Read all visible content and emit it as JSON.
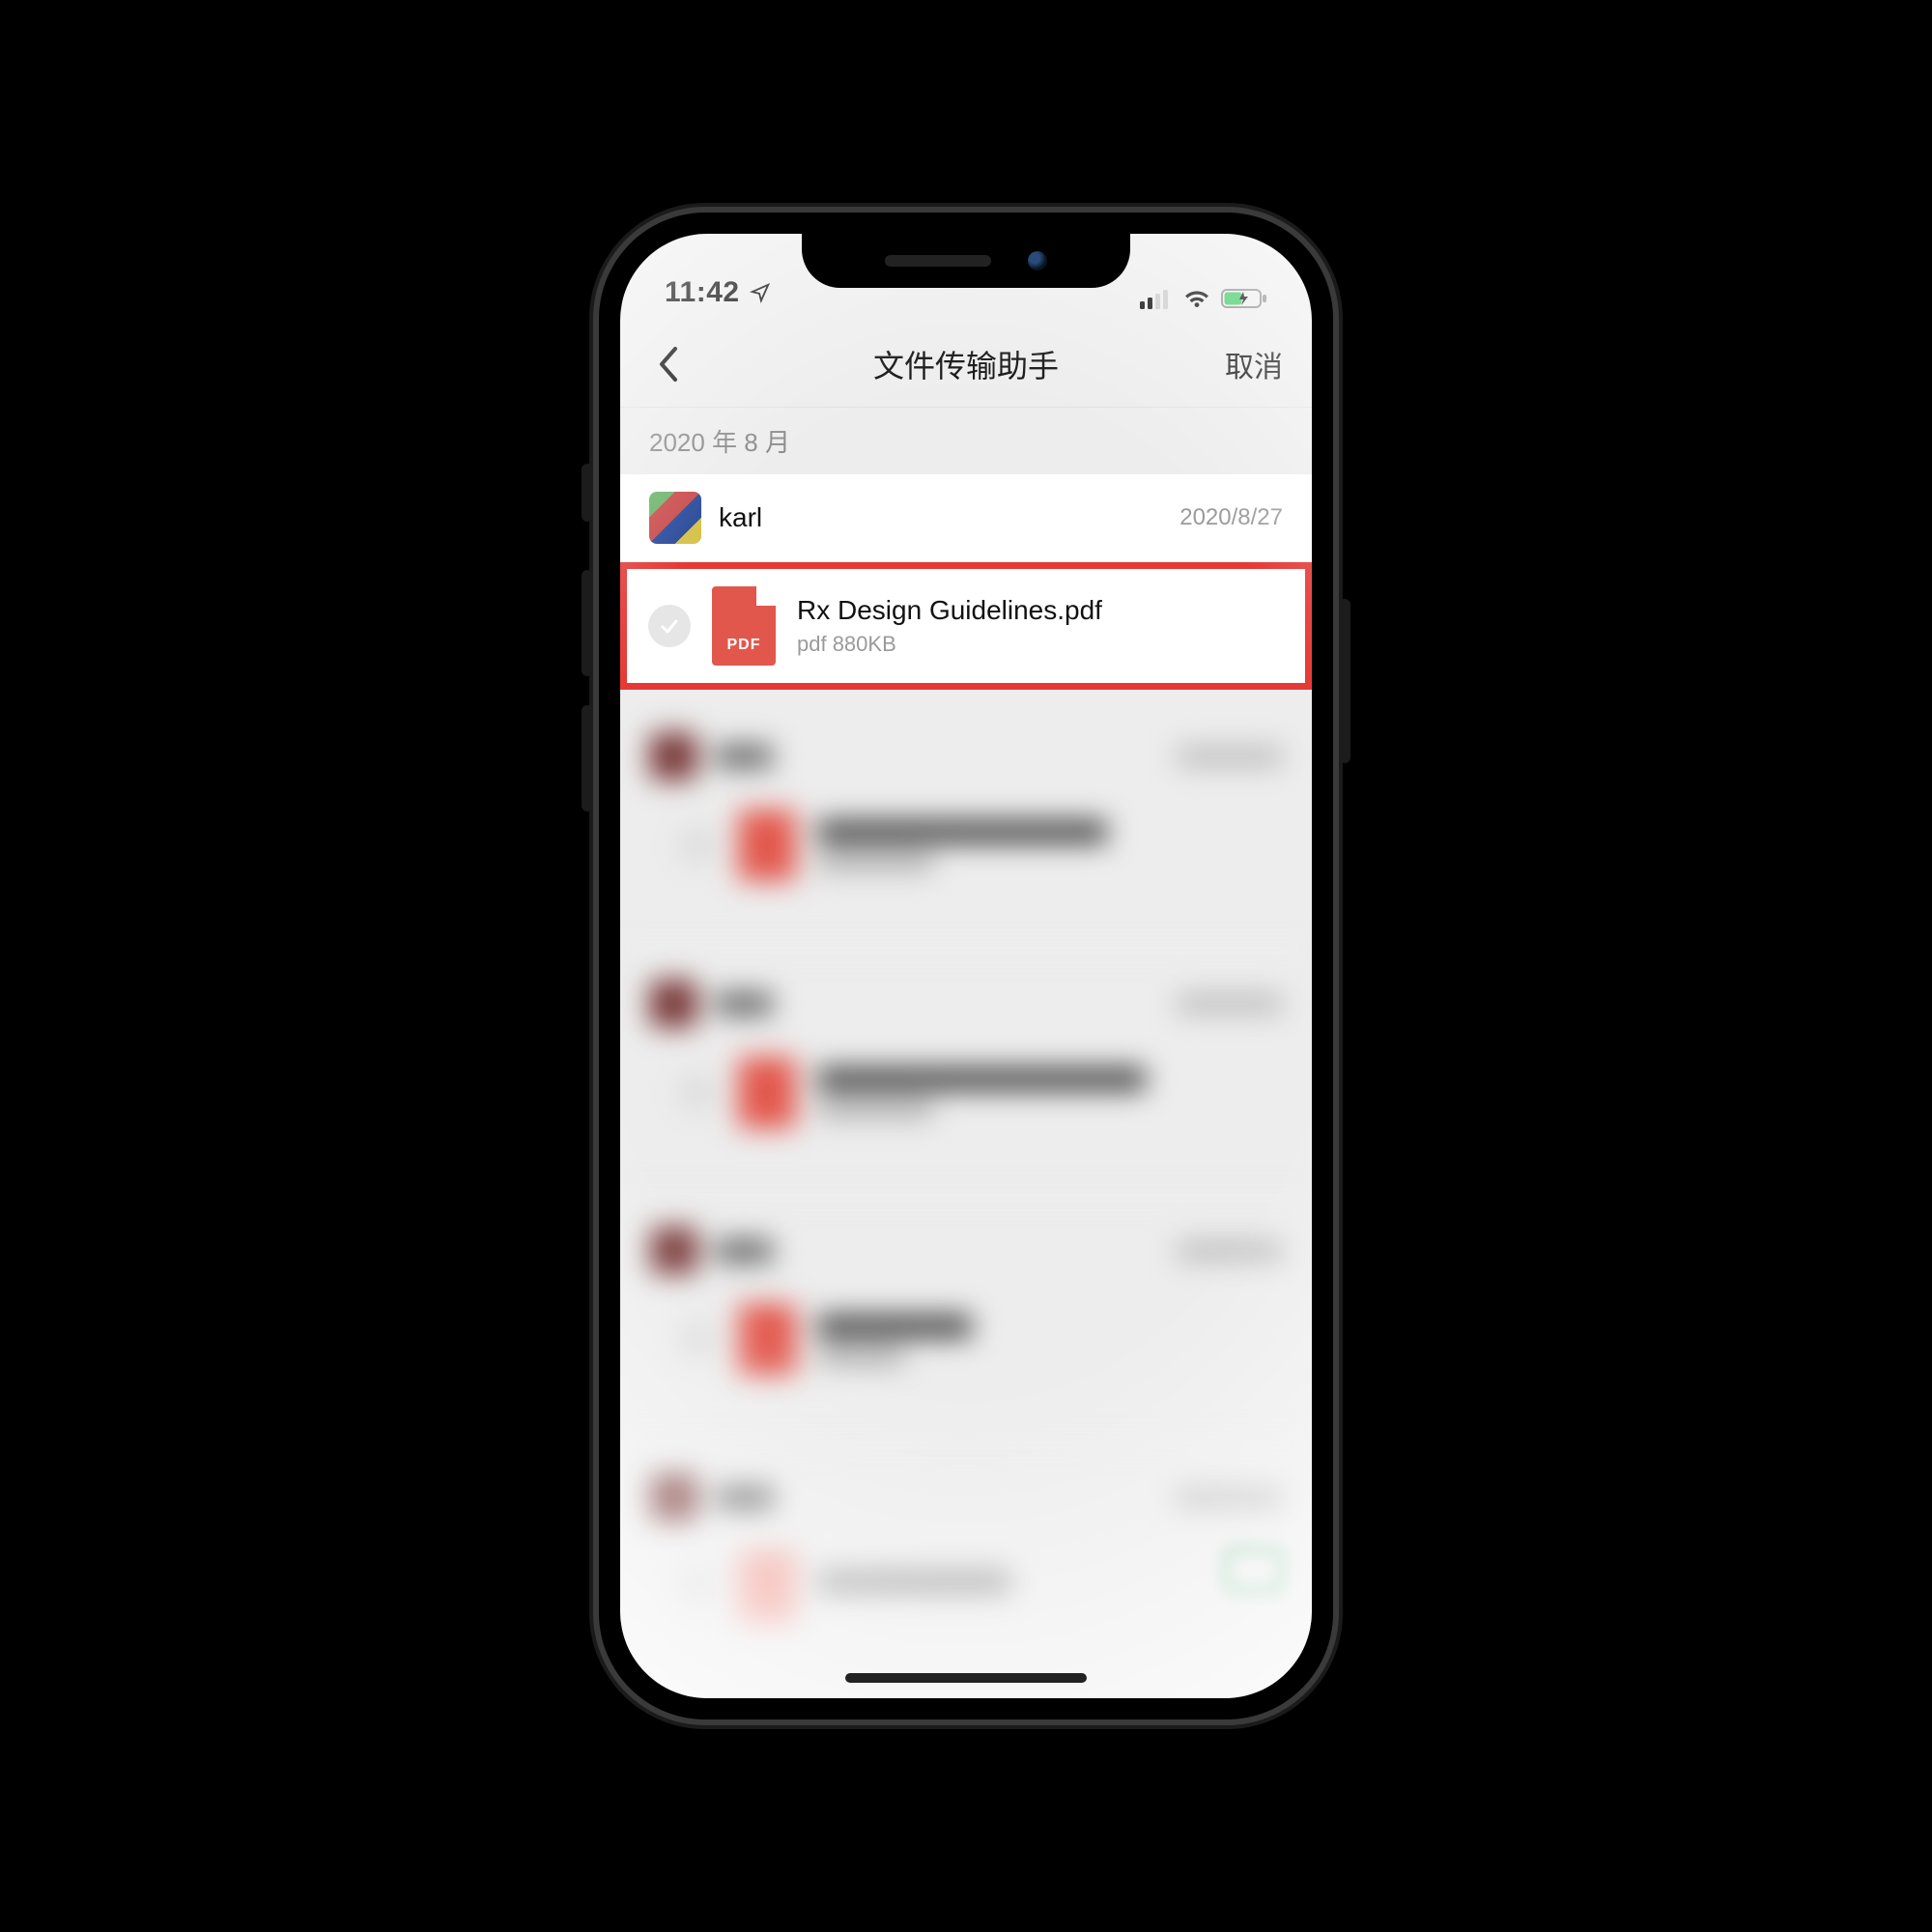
{
  "statusbar": {
    "time": "11:42",
    "location_icon": "location-icon",
    "signal_icon": "signal-icon",
    "wifi_icon": "wifi-icon",
    "battery_icon": "battery-charging-icon"
  },
  "nav": {
    "back_icon": "chevron-left-icon",
    "title": "文件传输助手",
    "cancel_label": "取消"
  },
  "section": {
    "date_header": "2020 年 8 月"
  },
  "sender": {
    "name": "karl",
    "date": "2020/8/27"
  },
  "highlighted_file": {
    "check_icon": "checkmark-circle-icon",
    "badge": "PDF",
    "name": "Rx Design Guidelines.pdf",
    "subtitle": "pdf 880KB"
  },
  "colors": {
    "highlight_border": "#e53935",
    "pdf_red": "#e2574c",
    "battery_green": "#34c759"
  }
}
